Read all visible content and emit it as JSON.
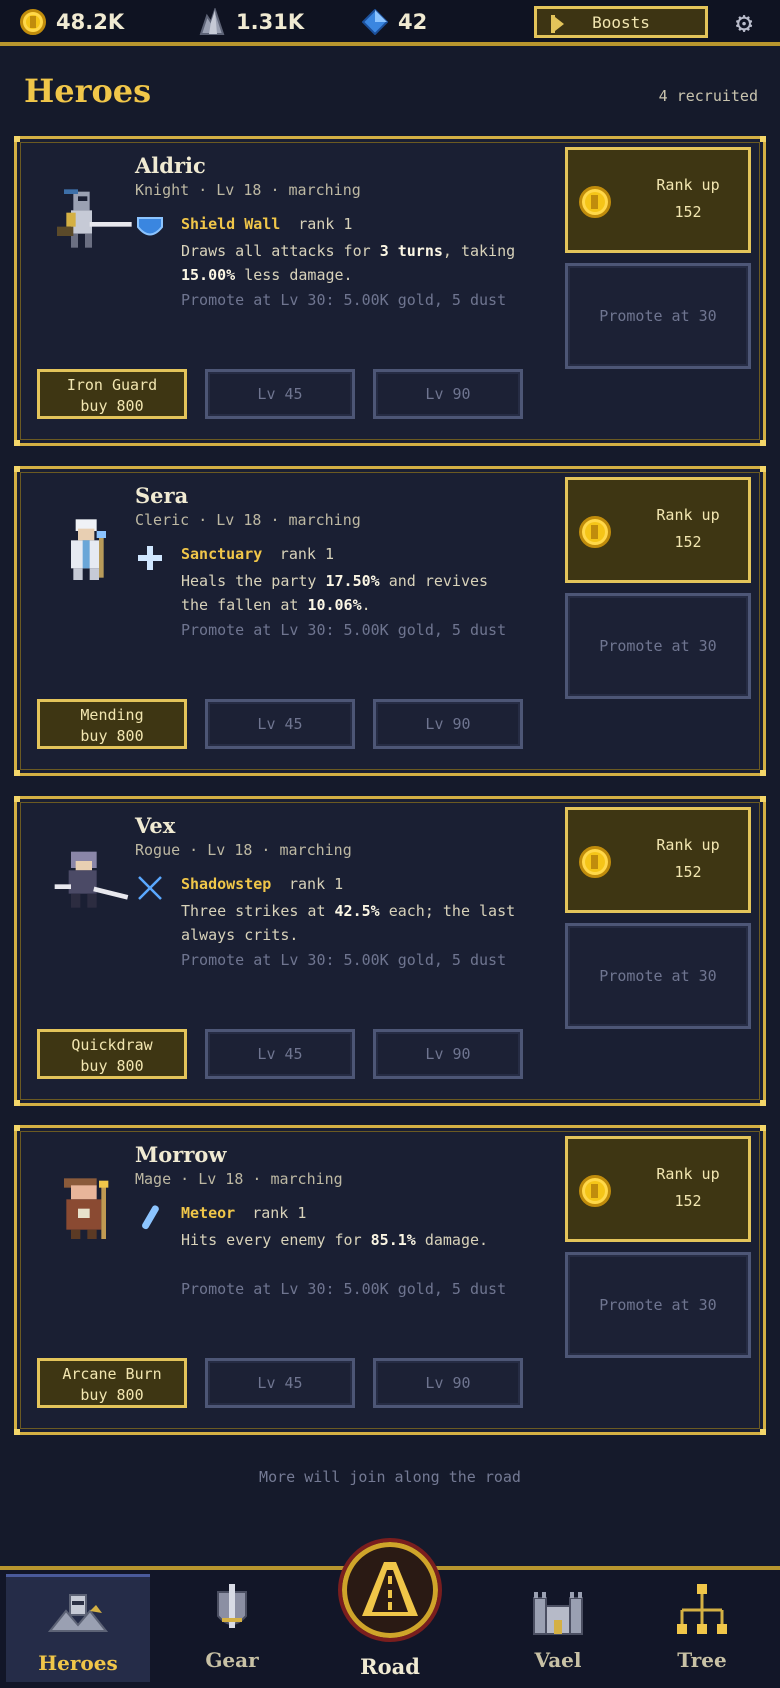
{
  "resources": {
    "gold": "48.2K",
    "stone": "1.31K",
    "gems": "42"
  },
  "boosts_label": "Boosts",
  "page": {
    "title": "Heroes",
    "recruited": "4 recruited"
  },
  "heroes": [
    {
      "name": "Aldric",
      "sub": "Knight · Lv 18 · marching",
      "skill": "Shield Wall",
      "rank": "rank 1",
      "desc_parts": [
        "Draws all attacks for ",
        "3 turns",
        ", taking ",
        "15.00%",
        " less damage."
      ],
      "promote_note": "Promote at Lv 30: 5.00K gold, 5 dust",
      "rankup_label": "Rank up",
      "rankup_cost": "152",
      "promote_label": "Promote at 30",
      "unlock_name": "Iron Guard",
      "unlock_cost": "buy 800",
      "lock1": "Lv 45",
      "lock2": "Lv 90"
    },
    {
      "name": "Sera",
      "sub": "Cleric · Lv 18 · marching",
      "skill": "Sanctuary",
      "rank": "rank 1",
      "desc_parts": [
        "Heals the party ",
        "17.50%",
        " and revives the fallen at ",
        "10.06%",
        "."
      ],
      "promote_note": "Promote at Lv 30: 5.00K gold, 5 dust",
      "rankup_label": "Rank up",
      "rankup_cost": "152",
      "promote_label": "Promote at 30",
      "unlock_name": "Mending",
      "unlock_cost": "buy 800",
      "lock1": "Lv 45",
      "lock2": "Lv 90"
    },
    {
      "name": "Vex",
      "sub": "Rogue · Lv 18 · marching",
      "skill": "Shadowstep",
      "rank": "rank 1",
      "desc_parts": [
        "Three strikes at ",
        "42.5%",
        " each; the last always crits.",
        "",
        ""
      ],
      "promote_note": "Promote at Lv 30: 5.00K gold, 5 dust",
      "rankup_label": "Rank up",
      "rankup_cost": "152",
      "promote_label": "Promote at 30",
      "unlock_name": "Quickdraw",
      "unlock_cost": "buy 800",
      "lock1": "Lv 45",
      "lock2": "Lv 90"
    },
    {
      "name": "Morrow",
      "sub": "Mage · Lv 18 · marching",
      "skill": "Meteor",
      "rank": "rank 1",
      "desc_parts": [
        "Hits every enemy for ",
        "85.1%",
        " damage.",
        "",
        ""
      ],
      "promote_note": "Promote at Lv 30: 5.00K gold, 5 dust",
      "rankup_label": "Rank up",
      "rankup_cost": "152",
      "promote_label": "Promote at 30",
      "unlock_name": "Arcane Burn",
      "unlock_cost": "buy 800",
      "lock1": "Lv 45",
      "lock2": "Lv 90"
    }
  ],
  "footer_note": "More will join along the road",
  "nav": {
    "heroes": "Heroes",
    "gear": "Gear",
    "road": "Road",
    "vael": "Vael",
    "tree": "Tree"
  },
  "colors": {
    "accent_gold": "#f0c649",
    "background": "#151a2b",
    "card": "#1a1f33"
  }
}
